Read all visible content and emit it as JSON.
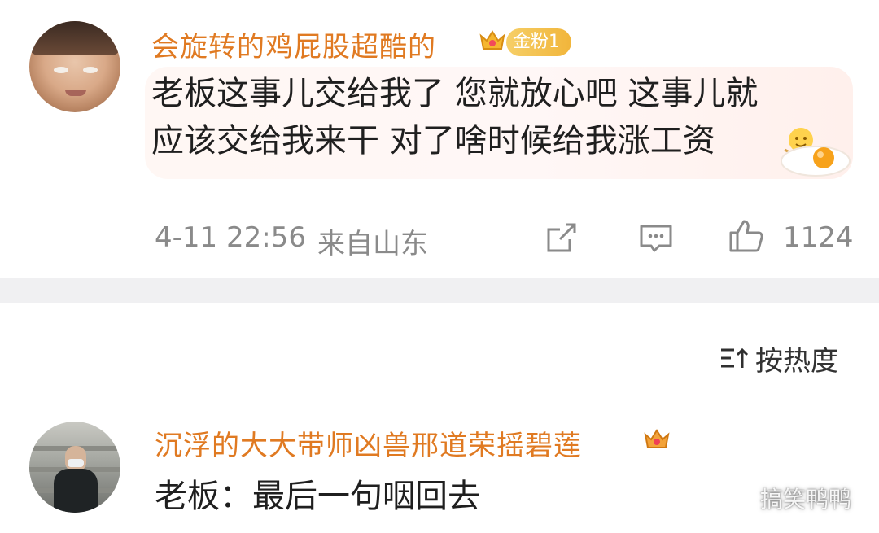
{
  "top_comment": {
    "username": "会旋转的鸡屁股超酷的",
    "fan_badge": "金粉1",
    "text_line1": "老板这事儿交给我了 您就放心吧 这事儿就",
    "text_line2": "应该交给我来干 对了啥时候给我涨工资",
    "timestamp": "4-11 22:56",
    "location": "来自山东",
    "like_count": "1124",
    "icons": [
      "crown-badge-icon",
      "sparkle-face-icon",
      "fried-egg-icon",
      "share-icon",
      "comment-icon",
      "like-icon"
    ]
  },
  "sort": {
    "label": "按热度",
    "icon": "sort-icon"
  },
  "second_comment": {
    "username": "沉浮的大大带师凶兽邢道荣摇碧莲",
    "text": "老板：最后一句咽回去",
    "icons": [
      "crown-badge-icon"
    ]
  },
  "watermark": {
    "text": "搞笑鸭鸭",
    "icon": "wechat-icon"
  },
  "colors": {
    "username": "#e07a22",
    "meta": "#8a8a8a",
    "band": "#f0f0f2",
    "bubble": "#fff7f4"
  }
}
